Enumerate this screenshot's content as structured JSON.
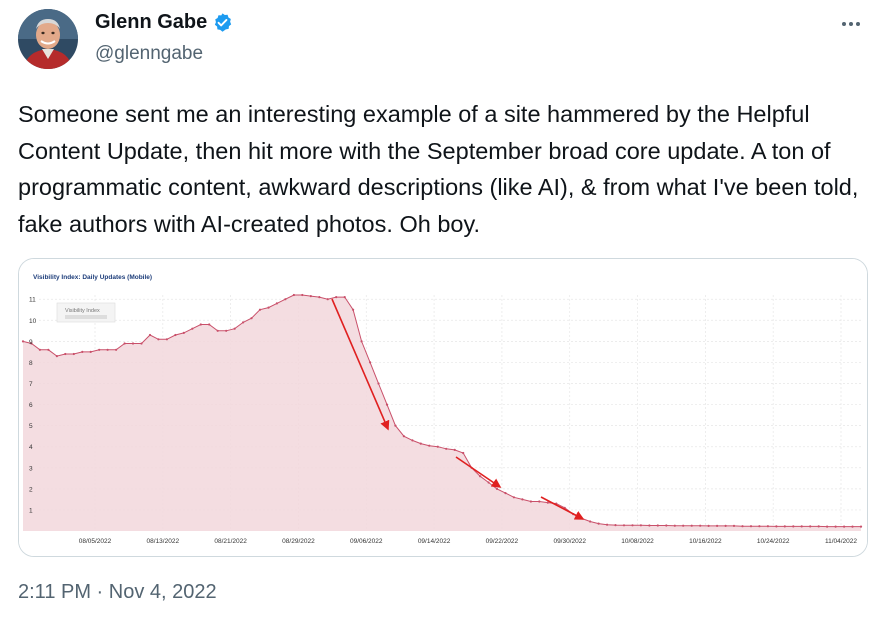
{
  "author": {
    "name": "Glenn Gabe",
    "handle": "@glenngabe",
    "verified": true,
    "avatar_icon": "profile-photo",
    "verified_icon": "verified-badge-icon",
    "verified_color": "#1d9bf0"
  },
  "more_menu": {
    "icon": "more-horizontal-icon"
  },
  "tweet": {
    "text": "Someone sent me an interesting example of a site hammered by the Helpful Content Update, then hit more with the September broad core update. A ton of programmatic content, awkward descriptions (like AI), & from what I've been told, fake authors with AI-created photos. Oh boy.",
    "timestamp": "2:11 PM · Nov 4, 2022"
  },
  "chart_data": {
    "type": "area",
    "title": "Visibility Index: Daily Updates (Mobile)",
    "tooltip_label": "Visibility Index",
    "x_labels": [
      "08/05/2022",
      "08/13/2022",
      "08/21/2022",
      "08/29/2022",
      "09/06/2022",
      "09/14/2022",
      "09/22/2022",
      "09/30/2022",
      "10/08/2022",
      "10/16/2022",
      "10/24/2022",
      "11/04/2022"
    ],
    "y_ticks": [
      1,
      2,
      3,
      4,
      5,
      6,
      7,
      8,
      9,
      10,
      11
    ],
    "ylim": [
      0,
      11.2
    ],
    "grid": true,
    "series": [
      {
        "color": "#c9506a",
        "fill": "#f2d7dc",
        "values": [
          9,
          8.9,
          8.6,
          8.6,
          8.3,
          8.4,
          8.4,
          8.5,
          8.5,
          8.6,
          8.6,
          8.6,
          8.9,
          8.9,
          8.9,
          9.3,
          9.1,
          9.1,
          9.3,
          9.4,
          9.6,
          9.8,
          9.8,
          9.5,
          9.5,
          9.6,
          9.9,
          10.1,
          10.5,
          10.6,
          10.8,
          11,
          11.2,
          11.2,
          11.15,
          11.1,
          11.0,
          11.1,
          11.1,
          10.5,
          9.0,
          8.0,
          7.0,
          6.0,
          5.0,
          4.5,
          4.3,
          4.15,
          4.05,
          4.0,
          3.9,
          3.85,
          3.7,
          3.0,
          2.6,
          2.3,
          2.0,
          1.8,
          1.6,
          1.5,
          1.4,
          1.4,
          1.35,
          1.3,
          1.1,
          0.8,
          0.6,
          0.45,
          0.35,
          0.3,
          0.28,
          0.27,
          0.27,
          0.27,
          0.26,
          0.26,
          0.26,
          0.25,
          0.25,
          0.25,
          0.25,
          0.24,
          0.24,
          0.24,
          0.24,
          0.23,
          0.23,
          0.23,
          0.23,
          0.22,
          0.22,
          0.22,
          0.22,
          0.22,
          0.22,
          0.21,
          0.21,
          0.21,
          0.21,
          0.21
        ]
      }
    ],
    "annotations": "three red arrows marking declines"
  }
}
